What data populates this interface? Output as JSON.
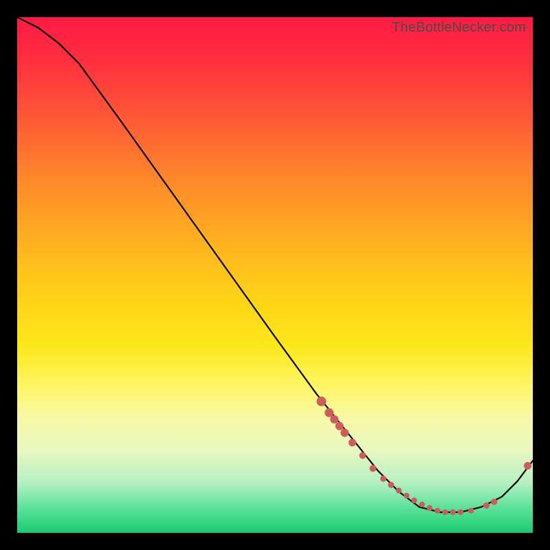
{
  "watermark": "TheBottleNecker.com",
  "chart_data": {
    "type": "line",
    "title": "",
    "xlabel": "",
    "ylabel": "",
    "xlim": [
      0,
      100
    ],
    "ylim": [
      0,
      100
    ],
    "series": [
      {
        "name": "curve",
        "x": [
          0,
          4,
          8,
          12,
          20,
          30,
          40,
          50,
          58,
          62,
          66,
          70,
          74,
          78,
          82,
          86,
          90,
          94,
          97,
          100
        ],
        "y": [
          100,
          98,
          95,
          91,
          80,
          66,
          52,
          38,
          27,
          22,
          17,
          12,
          8,
          5,
          4,
          4,
          5,
          7,
          10,
          14
        ]
      }
    ],
    "markers": {
      "name": "dots",
      "x": [
        59.0,
        60.5,
        61.5,
        62.5,
        63.5,
        65.0,
        67.0,
        69.0,
        71.0,
        72.5,
        74.0,
        75.5,
        77.0,
        78.5,
        80.0,
        81.5,
        83.0,
        84.5,
        86.0,
        88.0,
        91.0,
        92.5,
        99.0
      ],
      "y": [
        25.5,
        23.3,
        22.0,
        20.7,
        19.4,
        17.5,
        15.0,
        12.5,
        10.5,
        9.3,
        8.2,
        7.2,
        6.3,
        5.5,
        4.8,
        4.3,
        4.0,
        4.0,
        4.0,
        4.3,
        5.3,
        6.0,
        13.0
      ],
      "r": [
        7.0,
        6.5,
        6.0,
        6.0,
        6.0,
        5.5,
        5.0,
        5.0,
        4.5,
        4.5,
        4.2,
        4.2,
        4.2,
        4.2,
        4.2,
        4.2,
        4.2,
        4.2,
        4.2,
        4.2,
        4.6,
        4.6,
        5.5
      ],
      "color": "#cd5c5c"
    }
  }
}
